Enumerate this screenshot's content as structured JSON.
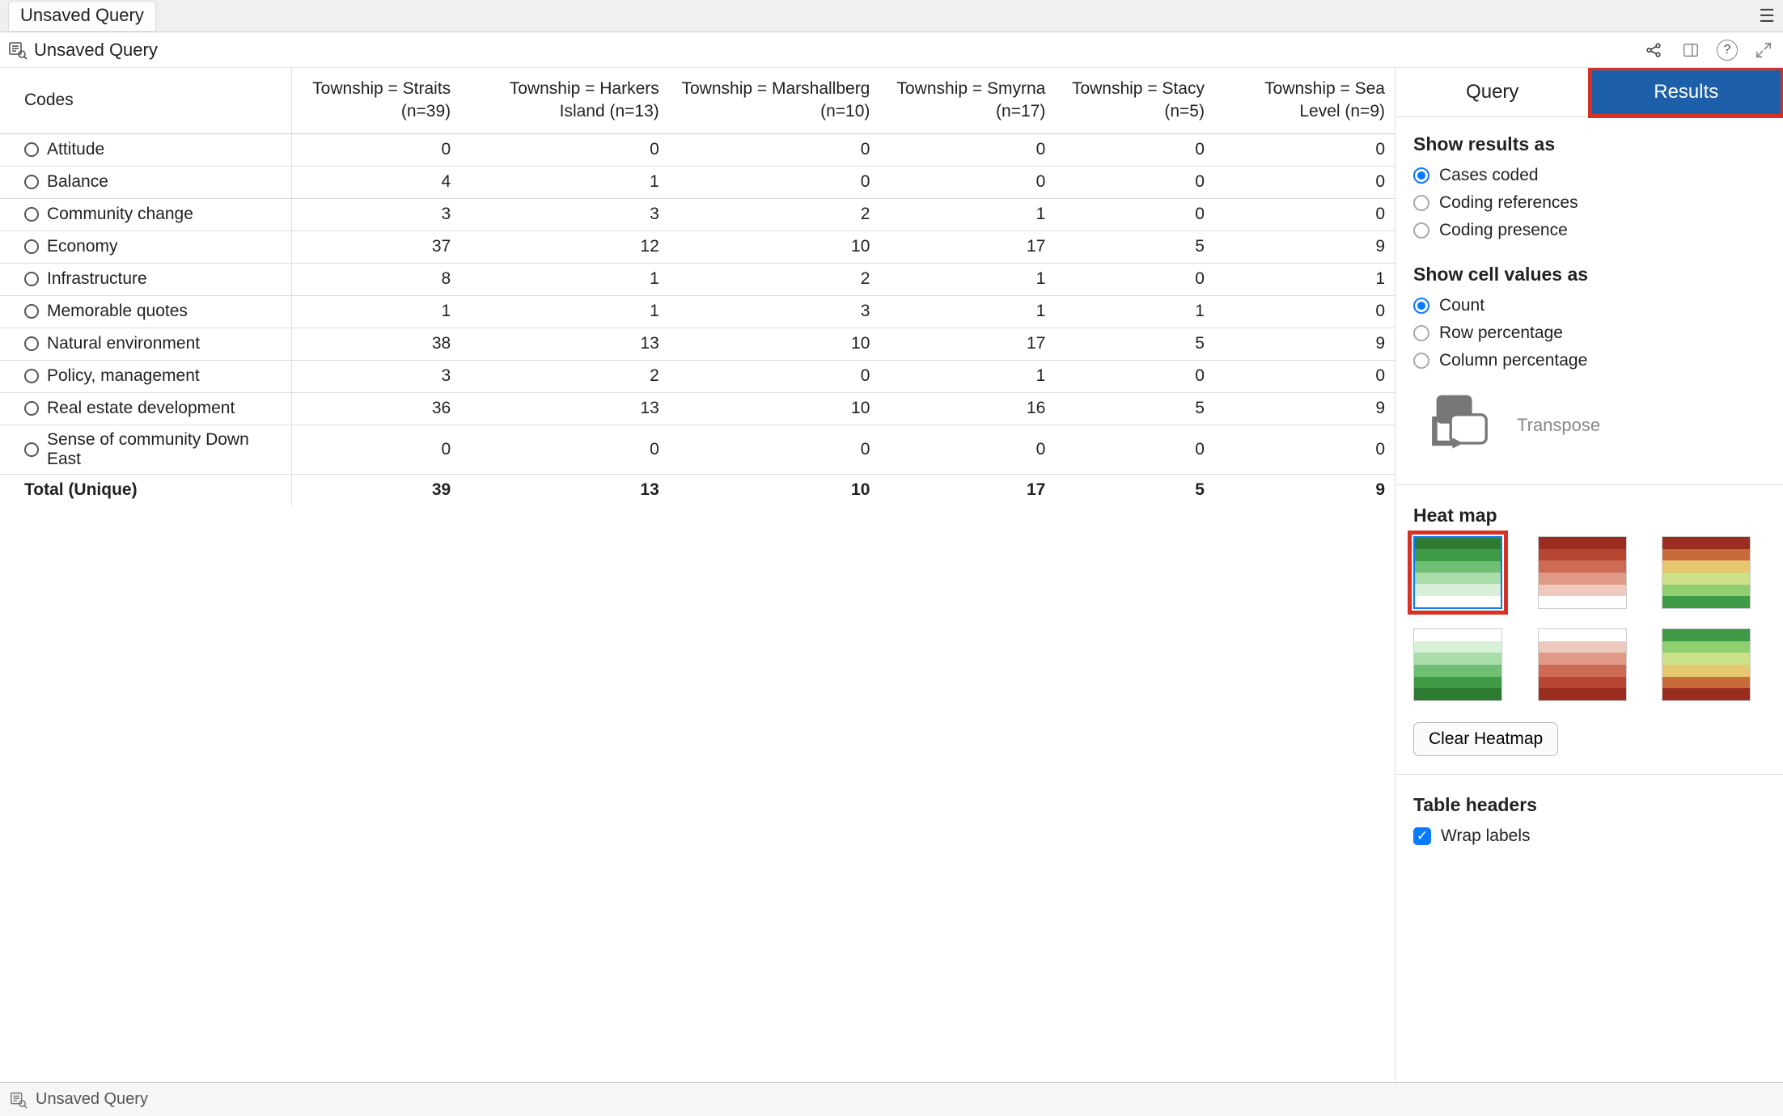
{
  "window": {
    "title": "Unsaved Query"
  },
  "toolbar": {
    "title": "Unsaved Query"
  },
  "footer": {
    "label": "Unsaved Query"
  },
  "tabs": {
    "query": "Query",
    "results": "Results",
    "active": "results"
  },
  "table": {
    "codes_header": "Codes",
    "columns": [
      "Township = Straits (n=39)",
      "Township = Harkers Island (n=13)",
      "Township = Marshallberg (n=10)",
      "Township = Smyrna (n=17)",
      "Township = Stacy (n=5)",
      "Township = Sea Level (n=9)"
    ],
    "rows": [
      {
        "label": "Attitude",
        "values": [
          0,
          0,
          0,
          0,
          0,
          0
        ]
      },
      {
        "label": "Balance",
        "values": [
          4,
          1,
          0,
          0,
          0,
          0
        ]
      },
      {
        "label": "Community change",
        "values": [
          3,
          3,
          2,
          1,
          0,
          0
        ]
      },
      {
        "label": "Economy",
        "values": [
          37,
          12,
          10,
          17,
          5,
          9
        ]
      },
      {
        "label": "Infrastructure",
        "values": [
          8,
          1,
          2,
          1,
          0,
          1
        ]
      },
      {
        "label": "Memorable quotes",
        "values": [
          1,
          1,
          3,
          1,
          1,
          0
        ]
      },
      {
        "label": "Natural environment",
        "values": [
          38,
          13,
          10,
          17,
          5,
          9
        ]
      },
      {
        "label": "Policy, management",
        "values": [
          3,
          2,
          0,
          1,
          0,
          0
        ]
      },
      {
        "label": "Real estate development",
        "values": [
          36,
          13,
          10,
          16,
          5,
          9
        ]
      },
      {
        "label": "Sense of community Down East",
        "values": [
          0,
          0,
          0,
          0,
          0,
          0
        ]
      }
    ],
    "total_label": "Total (Unique)",
    "totals": [
      39,
      13,
      10,
      17,
      5,
      9
    ]
  },
  "panel": {
    "showResultsAs": {
      "heading": "Show results as",
      "options": [
        "Cases coded",
        "Coding references",
        "Coding presence"
      ],
      "selected": 0
    },
    "showCellValuesAs": {
      "heading": "Show cell values as",
      "options": [
        "Count",
        "Row percentage",
        "Column percentage"
      ],
      "selected": 0
    },
    "transpose": "Transpose",
    "heatmap": {
      "heading": "Heat map",
      "palettes": [
        [
          "#2d7a33",
          "#3f9a46",
          "#6fbf73",
          "#a8dca9",
          "#d8efd8",
          "#ffffff"
        ],
        [
          "#9b2d20",
          "#b64532",
          "#cc6a54",
          "#df9a86",
          "#efc9be",
          "#ffffff"
        ],
        [
          "#9b2d20",
          "#c96a3a",
          "#e6c66f",
          "#cde08a",
          "#8fcf72",
          "#3f9a46"
        ],
        [
          "#ffffff",
          "#d8efd8",
          "#a8dca9",
          "#6fbf73",
          "#3f9a46",
          "#2d7a33"
        ],
        [
          "#ffffff",
          "#efc9be",
          "#df9a86",
          "#cc6a54",
          "#b64532",
          "#9b2d20"
        ],
        [
          "#3f9a46",
          "#8fcf72",
          "#cde08a",
          "#e6c66f",
          "#c96a3a",
          "#9b2d20"
        ]
      ],
      "selected": 0,
      "clear": "Clear Heatmap"
    },
    "tableHeaders": {
      "heading": "Table headers",
      "wrapLabels": {
        "label": "Wrap labels",
        "checked": true
      }
    }
  }
}
